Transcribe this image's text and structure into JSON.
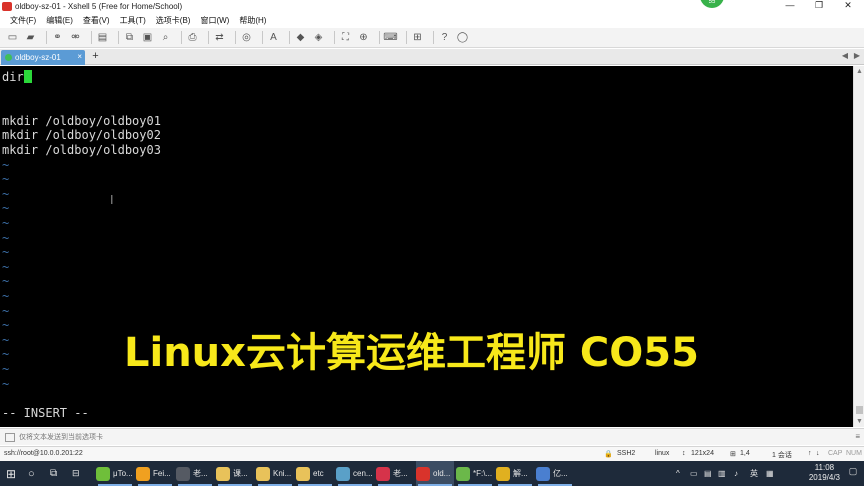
{
  "window": {
    "title": "oldboy-sz-01 - Xshell 5 (Free for Home/School)",
    "badge": "55",
    "minimize": "—",
    "maximize": "❐",
    "close": "✕"
  },
  "menu": {
    "items": [
      "文件(F)",
      "编辑(E)",
      "查看(V)",
      "工具(T)",
      "选项卡(B)",
      "窗口(W)",
      "帮助(H)"
    ]
  },
  "tabs": {
    "active_label": "oldboy-sz-01",
    "close": "×",
    "add": "+",
    "prev": "◀",
    "next": "▶"
  },
  "terminal": {
    "lines": [
      {
        "text": "dir",
        "cursor": true
      },
      {
        "text": ""
      },
      {
        "text": ""
      },
      {
        "text": "mkdir /oldboy/oldboy01"
      },
      {
        "text": "mkdir /oldboy/oldboy02"
      },
      {
        "text": "mkdir /oldboy/oldboy03"
      }
    ],
    "tilde": "~",
    "tilde_count": 16,
    "mode": "-- INSERT --",
    "cursor_color": "#2bd83a",
    "tilde_color": "#3b6ea5"
  },
  "overlay": {
    "caption": "Linux云计算运维工程师 CO55",
    "caption_color": "#f7e81a"
  },
  "compose": {
    "placeholder": "仅将文本发送到当前选项卡",
    "menu": "≡"
  },
  "status": {
    "connection": "ssh://root@10.0.0.201:22",
    "protocol": "SSH2",
    "term": "linux",
    "size": "121x24",
    "position": "1,4",
    "sessions": "1 会话",
    "cap": "CAP",
    "num": "NUM"
  },
  "taskbar": {
    "items": [
      {
        "label": "μTo...",
        "icon": "utorrent-icon",
        "color": "#6fbf3a"
      },
      {
        "label": "Fei...",
        "icon": "feiq-icon",
        "color": "#f0a020"
      },
      {
        "label": "老...",
        "icon": "video-icon",
        "color": "#555a63"
      },
      {
        "label": "课...",
        "icon": "folder-icon",
        "color": "#e8c25a"
      },
      {
        "label": "Kni...",
        "icon": "folder-icon",
        "color": "#e8c25a"
      },
      {
        "label": "etc",
        "icon": "folder-icon",
        "color": "#e8c25a"
      },
      {
        "label": "cen...",
        "icon": "vmware-icon",
        "color": "#5aa0c8"
      },
      {
        "label": "老...",
        "icon": "xmind-icon",
        "color": "#d6334a"
      },
      {
        "label": "old...",
        "icon": "xshell-icon",
        "color": "#d9332b",
        "active": true
      },
      {
        "label": "*F:\\...",
        "icon": "notepad-icon",
        "color": "#6bb84a"
      },
      {
        "label": "解...",
        "icon": "chrome-icon",
        "color": "#e0b020"
      },
      {
        "label": "亿...",
        "icon": "doc-icon",
        "color": "#4a7fd0"
      }
    ],
    "tray": {
      "chevron": "^",
      "lang": "英",
      "time": "11:08",
      "date": "2019/4/3"
    }
  }
}
